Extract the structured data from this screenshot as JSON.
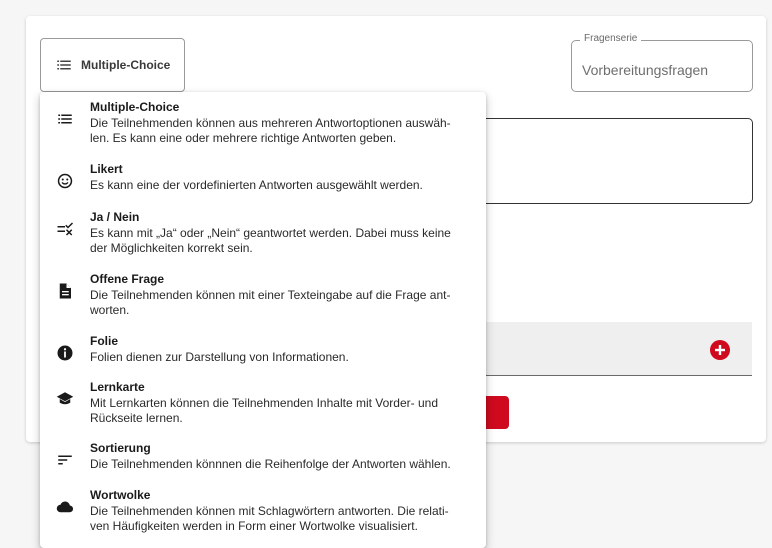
{
  "question_type_button": {
    "label": "Multiple-Choice",
    "icon": "list-icon"
  },
  "series_field": {
    "legend": "Fragenserie",
    "value": "Vorbereitungsfragen"
  },
  "colors": {
    "accent": "#cf0a1f"
  },
  "menu": {
    "items": [
      {
        "title": "Multiple-Choice",
        "icon": "list-icon",
        "desc_lines": [
          "Die Teilnehmenden können aus mehreren Antwortoptionen auswäh-",
          "len. Es kann eine oder mehrere richtige Antworten geben."
        ]
      },
      {
        "title": "Likert",
        "icon": "smiley-icon",
        "desc_lines": [
          "Es kann eine der vordefinierten Antworten ausgewählt werden."
        ]
      },
      {
        "title": "Ja / Nein",
        "icon": "yes-no-icon",
        "desc_lines": [
          "Es kann mit „Ja“ oder „Nein“ geantwortet werden. Dabei muss keine",
          "der Möglichkeiten korrekt sein."
        ]
      },
      {
        "title": "Offene Frage",
        "icon": "document-icon",
        "desc_lines": [
          "Die Teilnehmenden können mit einer Texteingabe auf die Frage ant-",
          "worten."
        ]
      },
      {
        "title": "Folie",
        "icon": "info-icon",
        "desc_lines": [
          "Folien dienen zur Darstellung von Informationen."
        ]
      },
      {
        "title": "Lernkarte",
        "icon": "graduation-cap-icon",
        "desc_lines": [
          "Mit Lernkarten können die Teilnehmenden Inhalte mit Vorder- und",
          "Rückseite lernen."
        ]
      },
      {
        "title": "Sortierung",
        "icon": "sort-icon",
        "desc_lines": [
          "Die Teilnehmenden könnnen die Reihenfolge der Antworten wählen."
        ]
      },
      {
        "title": "Wortwolke",
        "icon": "cloud-icon",
        "desc_lines": [
          "Die Teilnehmenden können mit Schlagwörtern antworten. Die relati-",
          "ven Häufigkeiten werden in Form einer Wortwolke visualisiert."
        ]
      }
    ]
  }
}
